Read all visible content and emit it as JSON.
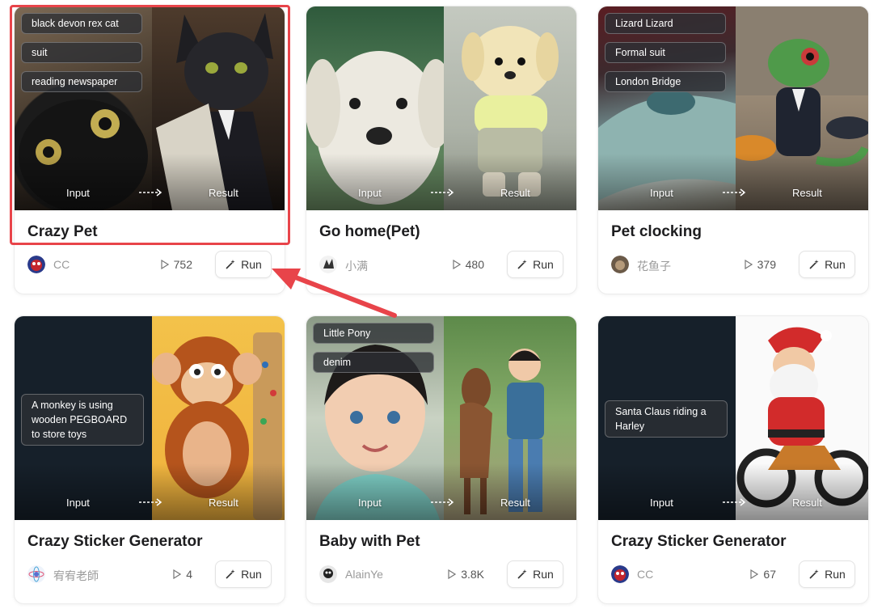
{
  "cards": [
    {
      "title": "Crazy Pet",
      "author": "CC",
      "plays": "752",
      "run_label": "Run",
      "input_label": "Input",
      "result_label": "Result",
      "tags": [
        "black devon rex cat",
        "suit",
        "reading newspaper"
      ]
    },
    {
      "title": "Go home(Pet)",
      "author": "小满",
      "plays": "480",
      "run_label": "Run",
      "input_label": "Input",
      "result_label": "Result",
      "tags": []
    },
    {
      "title": "Pet clocking",
      "author": "花鱼子",
      "plays": "379",
      "run_label": "Run",
      "input_label": "Input",
      "result_label": "Result",
      "tags": [
        "Lizard Lizard",
        "Formal suit",
        "London Bridge"
      ]
    },
    {
      "title": "Crazy Sticker Generator",
      "author": "宥宥老師",
      "plays": "4",
      "run_label": "Run",
      "input_label": "Input",
      "result_label": "Result",
      "tags": [
        "A monkey is using wooden PEGBOARD to store toys"
      ]
    },
    {
      "title": "Baby with Pet",
      "author": "AlainYe",
      "plays": "3.8K",
      "run_label": "Run",
      "input_label": "Input",
      "result_label": "Result",
      "tags": [
        "Little Pony",
        "denim"
      ]
    },
    {
      "title": "Crazy Sticker Generator",
      "author": "CC",
      "plays": "67",
      "run_label": "Run",
      "input_label": "Input",
      "result_label": "Result",
      "tags": [
        "Santa Claus riding a Harley"
      ]
    }
  ],
  "icons": {
    "play": "play-icon",
    "run": "magic-wand-icon"
  },
  "colors": {
    "highlight": "#e8444a",
    "title": "#1d1d1f",
    "author": "#9a9a9a"
  }
}
